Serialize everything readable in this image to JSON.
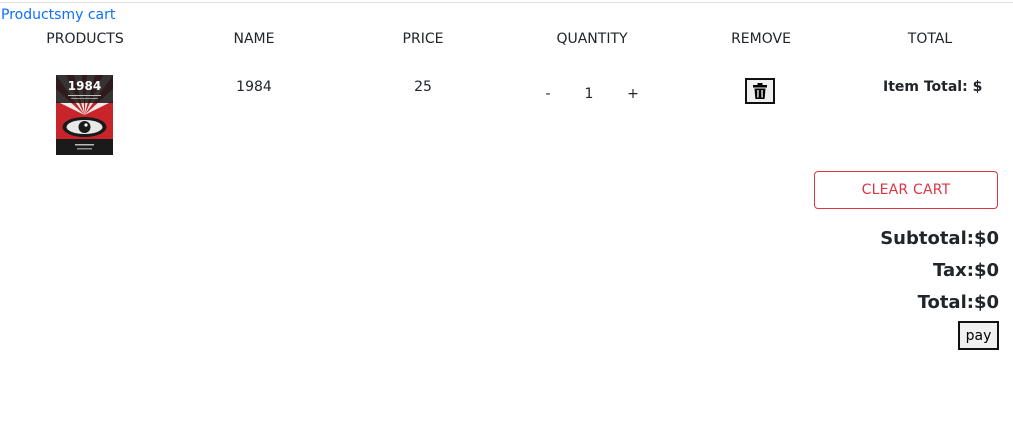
{
  "nav": {
    "products_link": "Products",
    "cart_link": "my cart"
  },
  "table": {
    "headers": [
      "PRODUCTS",
      "NAME",
      "PRICE",
      "QUANTITY",
      "REMOVE",
      "TOTAL"
    ],
    "rows": [
      {
        "cover_title": "1984",
        "name": "1984",
        "price": "25",
        "quantity": "1",
        "decrement": "-",
        "increment": "+",
        "remove_icon": "trash-icon",
        "item_total": "Item Total: $"
      }
    ]
  },
  "actions": {
    "clear_cart": "CLEAR CART",
    "pay": "pay"
  },
  "summary": {
    "subtotal": "Subtotal:$0",
    "tax": "Tax:$0",
    "total": "Total:$0"
  },
  "colors": {
    "link": "#0d6efd",
    "danger": "#dc3545",
    "cover_red": "#c8242b",
    "cover_dark": "#1a1a1a"
  }
}
